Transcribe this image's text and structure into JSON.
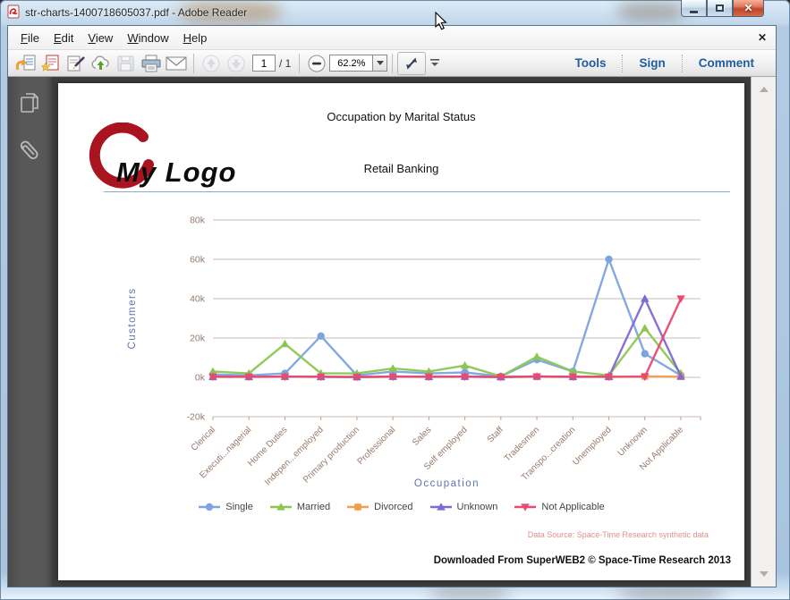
{
  "window": {
    "title": "str-charts-1400718605037.pdf - Adobe Reader"
  },
  "menu": {
    "items": [
      "File",
      "Edit",
      "View",
      "Window",
      "Help"
    ],
    "close_button": "✕"
  },
  "toolbar": {
    "page_current": "1",
    "page_total": "/ 1",
    "zoom_level": "62.2%",
    "tools_label": "Tools",
    "sign_label": "Sign",
    "comment_label": "Comment"
  },
  "page": {
    "title": "Occupation by Marital Status",
    "subtitle": "Retail Banking",
    "logo_text": "My Logo",
    "data_source": "Data Source: Space-Time Research synthetic data",
    "download_footer": "Downloaded From SuperWEB2 © Space-Time Research 2013"
  },
  "chart_data": {
    "type": "line",
    "title": "Occupation by Marital Status",
    "subtitle": "Retail Banking",
    "xlabel": "Occupation",
    "ylabel": "Customers",
    "ylim": [
      -20000,
      80000
    ],
    "yticks": [
      80000,
      60000,
      40000,
      20000,
      0,
      -20000
    ],
    "ytick_labels": [
      "80k",
      "60k",
      "40k",
      "20k",
      "0k",
      "-20k"
    ],
    "grid": true,
    "legend_position": "bottom",
    "categories": [
      "Clerical",
      "Executi...nagerial",
      "Home Duties",
      "Indepen...employed",
      "Primary production",
      "Professional",
      "Sales",
      "Self employed",
      "Staff",
      "Tradesmen",
      "Transpo...creation",
      "Unemployed",
      "Unknown",
      "Not Applicable"
    ],
    "series": [
      {
        "name": "Single",
        "color": "#7da4e0",
        "marker": "circle",
        "values": [
          1500,
          1000,
          2000,
          21000,
          1000,
          3000,
          2000,
          2500,
          500,
          9000,
          3000,
          60000,
          12000,
          1000
        ]
      },
      {
        "name": "Married",
        "color": "#8cc652",
        "marker": "triangle",
        "values": [
          3000,
          2000,
          17000,
          2000,
          2000,
          4500,
          3000,
          6000,
          500,
          10500,
          3000,
          1000,
          25000,
          2000
        ]
      },
      {
        "name": "Divorced",
        "color": "#f09d4e",
        "marker": "square",
        "values": [
          200,
          200,
          300,
          200,
          100,
          300,
          200,
          300,
          100,
          300,
          200,
          200,
          500,
          300
        ]
      },
      {
        "name": "Unknown",
        "color": "#7e6ad2",
        "marker": "triangle",
        "values": [
          300,
          300,
          400,
          300,
          200,
          400,
          300,
          400,
          200,
          500,
          300,
          300,
          40000,
          500
        ]
      },
      {
        "name": "Not Applicable",
        "color": "#e84a70",
        "marker": "triangle-down",
        "values": [
          300,
          300,
          300,
          300,
          200,
          300,
          300,
          300,
          200,
          400,
          300,
          300,
          300,
          40000
        ]
      }
    ],
    "colors": {
      "grid": "#ccbab0",
      "tick_text": "#96796c",
      "axis_title": "#5f74ad"
    }
  }
}
